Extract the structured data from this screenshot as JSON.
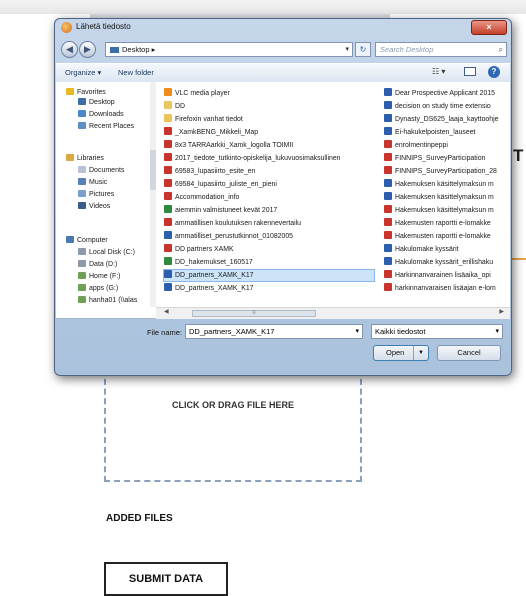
{
  "page": {
    "cut_heading_letter": "T",
    "drop_zone_text": "CLICK OR DRAG FILE HERE",
    "added_files_heading": "ADDED FILES",
    "submit_label": "SUBMIT DATA"
  },
  "dialog": {
    "title": "Lähetä tiedosto",
    "close_glyph": "×",
    "address": "Desktop",
    "search_placeholder": "Search Desktop",
    "toolbar": {
      "organize": "Organize ▾",
      "new_folder": "New folder",
      "views": "☷ ▾"
    },
    "nav_pane": [
      {
        "label": "Favorites",
        "icon": "star-icon",
        "color": "#e8b923",
        "sub": false
      },
      {
        "label": "Desktop",
        "icon": "desktop-icon",
        "color": "#3b6ea8",
        "sub": true
      },
      {
        "label": "Downloads",
        "icon": "downloads-icon",
        "color": "#4a88c9",
        "sub": true
      },
      {
        "label": "Recent Places",
        "icon": "recent-places-icon",
        "color": "#5f8dc4",
        "sub": true
      },
      {
        "label": "Libraries",
        "icon": "libraries-icon",
        "color": "#d9a941",
        "sub": false
      },
      {
        "label": "Documents",
        "icon": "documents-icon",
        "color": "#b7c3d4",
        "sub": true
      },
      {
        "label": "Music",
        "icon": "music-icon",
        "color": "#5a7fb5",
        "sub": true
      },
      {
        "label": "Pictures",
        "icon": "pictures-icon",
        "color": "#7a9fca",
        "sub": true
      },
      {
        "label": "Videos",
        "icon": "videos-icon",
        "color": "#3c5c88",
        "sub": true
      },
      {
        "label": "Computer",
        "icon": "computer-icon",
        "color": "#4b78ae",
        "sub": false
      },
      {
        "label": "Local Disk (C:)",
        "icon": "disk-icon",
        "color": "#8c99aa",
        "sub": true
      },
      {
        "label": "Data (D:)",
        "icon": "disk-icon",
        "color": "#8c99aa",
        "sub": true
      },
      {
        "label": "Home (F:)",
        "icon": "network-drive-icon",
        "color": "#6fa054",
        "sub": true
      },
      {
        "label": "apps (G:)",
        "icon": "network-drive-icon",
        "color": "#6fa054",
        "sub": true
      },
      {
        "label": "hanha01 (\\\\alas",
        "icon": "network-drive-icon",
        "color": "#6fa054",
        "sub": true
      }
    ],
    "files_col1": [
      {
        "name": "VLC media player",
        "icon": "vlc-icon",
        "color": "#f08a1c"
      },
      {
        "name": "DD",
        "icon": "folder-icon",
        "color": "#e9c659"
      },
      {
        "name": "Firefoxin vanhat tiedot",
        "icon": "folder-icon",
        "color": "#e9c659"
      },
      {
        "name": "_XamkBENG_Mikkeli_Map",
        "icon": "pdf-icon",
        "color": "#c8332b"
      },
      {
        "name": "8x3 TARRAarkki_Xamk_logolla TOIMII",
        "icon": "pdf-icon",
        "color": "#c8332b"
      },
      {
        "name": "2017_tiedote_tutkinto-opiskelija_lukuvuosimaksullinen",
        "icon": "pdf-icon",
        "color": "#c8332b"
      },
      {
        "name": "69583_lupasiirto_esite_en",
        "icon": "pdf-icon",
        "color": "#c8332b"
      },
      {
        "name": "69584_lupasiirto_juliste_en_pieni",
        "icon": "pdf-icon",
        "color": "#c8332b"
      },
      {
        "name": "Accommodation_info",
        "icon": "pdf-icon",
        "color": "#c8332b"
      },
      {
        "name": "aiemmin valmistuneet kevät 2017",
        "icon": "excel-icon",
        "color": "#2f8a3e"
      },
      {
        "name": "ammatillisen koulutuksen rakennevertailu",
        "icon": "pdf-icon",
        "color": "#c8332b"
      },
      {
        "name": "ammatilliset_perustutkinnot_01082005",
        "icon": "word-icon",
        "color": "#2b5fae"
      },
      {
        "name": "DD partners XAMK",
        "icon": "pdf-icon",
        "color": "#c8332b"
      },
      {
        "name": "DD_hakemukset_160517",
        "icon": "excel-icon",
        "color": "#2f8a3e"
      },
      {
        "name": "DD_partners_XAMK_K17",
        "icon": "word-icon",
        "color": "#2b5fae",
        "selected": true
      },
      {
        "name": "DD_partners_XAMK_K17",
        "icon": "word-icon",
        "color": "#2b5fae"
      }
    ],
    "files_col2": [
      {
        "name": "Dear Prospective Applicant 2015",
        "icon": "word-icon",
        "color": "#2b5fae"
      },
      {
        "name": "decision on study time extensio",
        "icon": "word-icon",
        "color": "#2b5fae"
      },
      {
        "name": "Dynasty_DS625_laaja_kayttoohje",
        "icon": "word-icon",
        "color": "#2b5fae"
      },
      {
        "name": "Ei-hakukelpoisten_lauseet",
        "icon": "word-icon",
        "color": "#2b5fae"
      },
      {
        "name": "enrolmentinpeppi",
        "icon": "pdf-icon",
        "color": "#c8332b"
      },
      {
        "name": "FINNIPS_SurveyParticipation",
        "icon": "pdf-icon",
        "color": "#c8332b"
      },
      {
        "name": "FINNIPS_SurveyParticipation_28",
        "icon": "pdf-icon",
        "color": "#c8332b"
      },
      {
        "name": "Hakemuksen käsittelymaksun m",
        "icon": "word-icon",
        "color": "#2b5fae"
      },
      {
        "name": "Hakemuksen käsittelymaksun m",
        "icon": "word-icon",
        "color": "#2b5fae"
      },
      {
        "name": "Hakemuksen käsittelymaksun m",
        "icon": "pdf-icon",
        "color": "#c8332b"
      },
      {
        "name": "Hakemusten raportti e-lomakke",
        "icon": "pdf-icon",
        "color": "#c8332b"
      },
      {
        "name": "Hakemusten raportti e-lomakke",
        "icon": "pdf-icon",
        "color": "#c8332b"
      },
      {
        "name": "Hakulomake kyssärit",
        "icon": "word-icon",
        "color": "#2b5fae"
      },
      {
        "name": "Hakulomake kyssärit_erillishaku",
        "icon": "word-icon",
        "color": "#2b5fae"
      },
      {
        "name": "Harkinnanvarainen lisäaika_opi",
        "icon": "pdf-icon",
        "color": "#c8332b"
      },
      {
        "name": "harkinnanvaraisen lisäajan e-lom",
        "icon": "pdf-icon",
        "color": "#c8332b"
      }
    ],
    "file_name_label": "File name:",
    "file_name_value": "DD_partners_XAMK_K17",
    "file_type_value": "Kaikki tiedostot",
    "open_label": "Open",
    "cancel_label": "Cancel"
  }
}
